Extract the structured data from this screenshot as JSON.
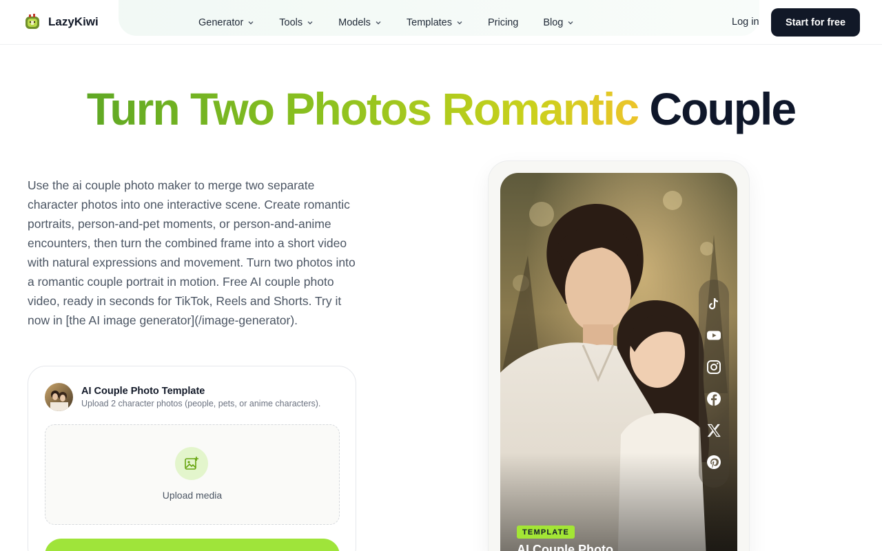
{
  "brand": {
    "name": "LazyKiwi",
    "logo_icon": "kiwi-logo-icon"
  },
  "nav": {
    "items": [
      {
        "label": "Generator",
        "has_dropdown": true
      },
      {
        "label": "Tools",
        "has_dropdown": true
      },
      {
        "label": "Models",
        "has_dropdown": true
      },
      {
        "label": "Templates",
        "has_dropdown": true
      },
      {
        "label": "Pricing",
        "has_dropdown": false
      },
      {
        "label": "Blog",
        "has_dropdown": true
      }
    ],
    "login_label": "Log in",
    "cta_label": "Start for free"
  },
  "hero": {
    "title_gradient": "Turn Two Photos Romantic",
    "title_dark": "Couple",
    "description": "Use the ai couple photo maker to merge two separate character photos into one interactive scene. Create romantic portraits, person-and-pet moments, or person-and-anime encounters, then turn the combined frame into a short video with natural expressions and movement. Turn two photos into a romantic couple portrait in motion. Free AI couple photo video, ready in seconds for TikTok, Reels and Shorts. Try it now in [the AI image generator](/image-generator)."
  },
  "template_card": {
    "title": "AI Couple Photo Template",
    "subtitle": "Upload 2 character photos (people, pets, or anime characters).",
    "upload_label": "Upload media"
  },
  "preview": {
    "badge": "TEMPLATE",
    "overlay_title": "AI Couple Photo",
    "social_icons": [
      "tiktok-icon",
      "youtube-icon",
      "instagram-icon",
      "facebook-icon",
      "x-icon",
      "pinterest-icon"
    ]
  },
  "colors": {
    "accent_green": "#a3e635",
    "dark": "#111827",
    "gradient_start": "#5fa824",
    "gradient_end": "#ecc42a"
  }
}
